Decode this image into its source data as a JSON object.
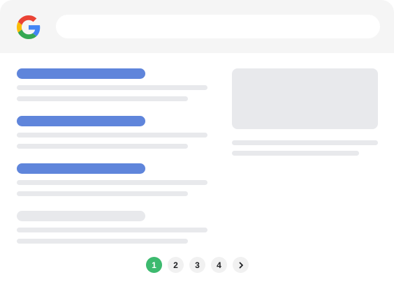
{
  "header": {
    "logo_icon": "google-g-icon",
    "search": {
      "value": "",
      "placeholder": ""
    }
  },
  "results": [
    {
      "type": "link",
      "title_color": "#5f85db"
    },
    {
      "type": "link",
      "title_color": "#5f85db"
    },
    {
      "type": "link",
      "title_color": "#5f85db"
    },
    {
      "type": "placeholder",
      "title_color": "#e8e9ec"
    }
  ],
  "knowledge_panel": {
    "image": "image-placeholder"
  },
  "pagination": {
    "pages": [
      "1",
      "2",
      "3",
      "4"
    ],
    "current": "1",
    "next_icon": "chevron-right-icon"
  },
  "colors": {
    "accent": "#3dba6f",
    "link": "#5f85db",
    "placeholder": "#e8e9ec",
    "header_bg": "#f5f5f5"
  }
}
